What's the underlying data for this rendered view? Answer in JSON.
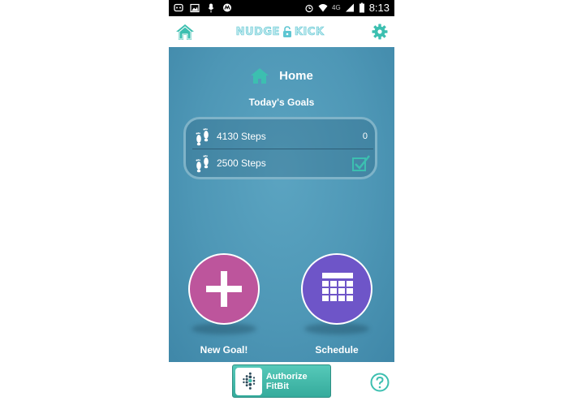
{
  "status_bar": {
    "network": "4G",
    "time": "8:13",
    "icons": [
      "mail-icon",
      "image-icon",
      "microphone-icon",
      "motorola-icon",
      "alarm-icon",
      "wifi-icon",
      "signal-icon",
      "battery-icon"
    ]
  },
  "app_bar": {
    "logo_left": "NUDGE",
    "logo_right": "KICK",
    "home_icon": "home-icon",
    "settings_icon": "gear-icon"
  },
  "page": {
    "title": "Home",
    "goals_heading": "Today's Goals",
    "goals": [
      {
        "label": "4130 Steps",
        "value": "0",
        "icon": "footprints-icon"
      },
      {
        "label": "2500 Steps",
        "value": "",
        "completed": true,
        "icon": "footprints-icon"
      }
    ]
  },
  "actions": {
    "new_goal": "New Goal!",
    "schedule": "Schedule"
  },
  "footer": {
    "authorize_label": "Authorize FitBit",
    "help_icon": "help-icon"
  },
  "colors": {
    "accent": "#3cbfb0",
    "background": "#4e97b6",
    "new_goal_button": "#bd559c",
    "schedule_button": "#6e55c8"
  }
}
